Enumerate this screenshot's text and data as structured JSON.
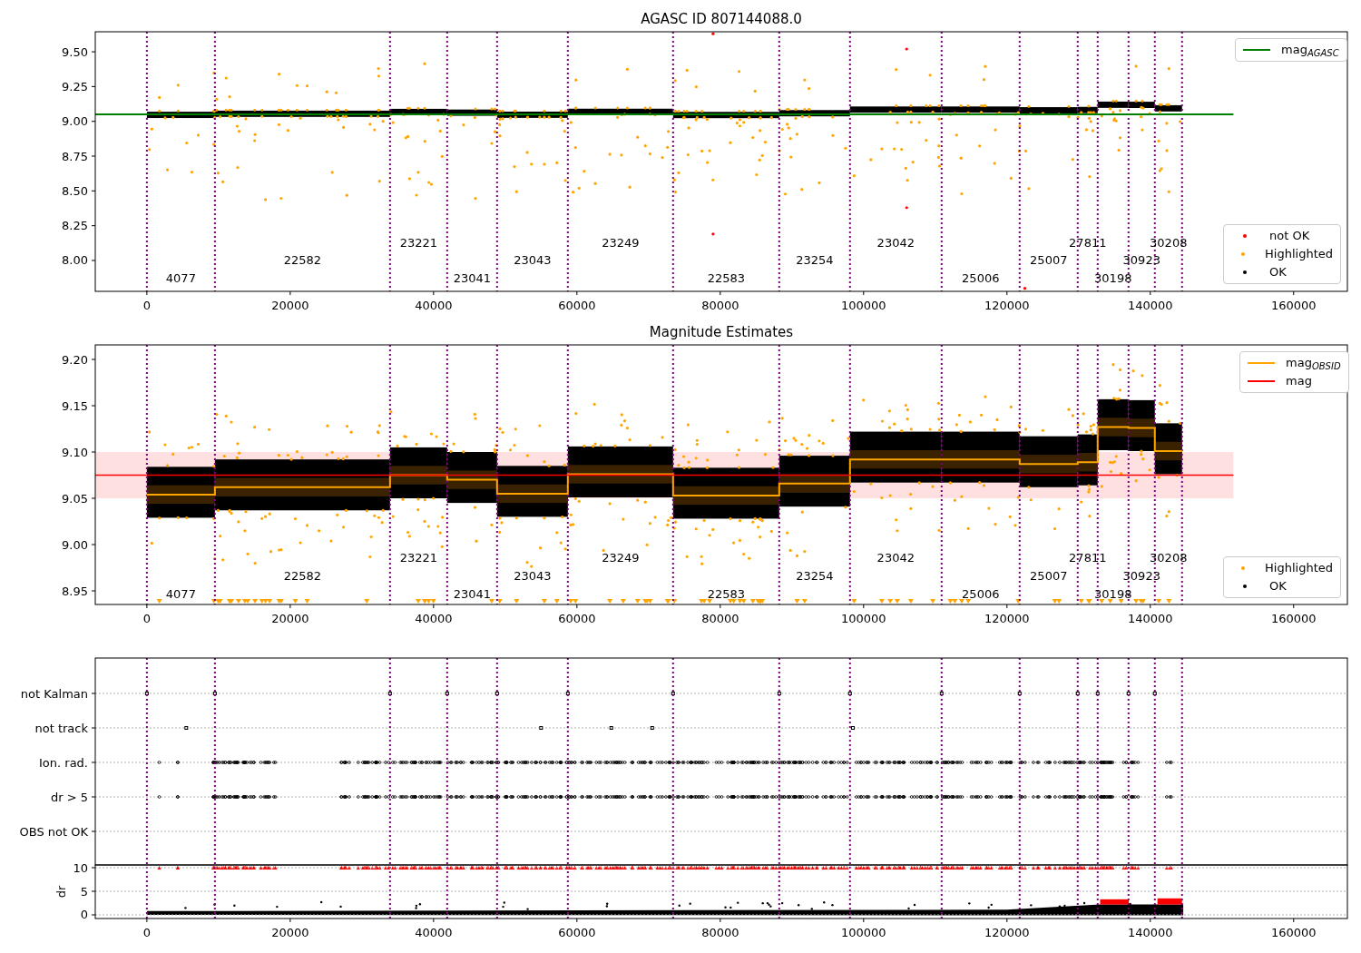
{
  "figure": [
    {
      "kind": "agasc",
      "legends": [
        {
          "kind": "points",
          "entries": [
            {
              "label": "not OK",
              "color": "#ff0000"
            },
            {
              "label": "Highlighted",
              "color": "#ffa500"
            },
            {
              "label": "OK",
              "color": "#000000"
            }
          ]
        }
      ],
      "chart_data": {
        "type": "line",
        "title": "AGASC ID 807144088.0",
        "x": [
          -7200,
          151600
        ],
        "series": [
          {
            "name": "mag$_{AGASC}$",
            "color": "#008000",
            "values": [
              9.05,
              9.05
            ]
          }
        ],
        "xlim": [
          -7200,
          167500
        ],
        "ylim": [
          7.778,
          9.644
        ],
        "xticks": [
          0,
          20000,
          40000,
          60000,
          80000,
          100000,
          120000,
          140000,
          160000
        ],
        "yticks": [
          {
            "value": 8,
            "label": "8.00"
          },
          {
            "value": 8.25,
            "label": "8.25"
          },
          {
            "value": 8.5,
            "label": "8.50"
          },
          {
            "value": 8.75,
            "label": "8.75"
          },
          {
            "value": 9,
            "label": "9.00"
          },
          {
            "value": 9.25,
            "label": "9.25"
          },
          {
            "value": 9.5,
            "label": "9.50"
          }
        ],
        "annotations": [
          "4077",
          "22582",
          "23221",
          "23041",
          "23043",
          "23249",
          "22583",
          "23254",
          "23042",
          "25006",
          "25007",
          "27811",
          "30198",
          "30923",
          "30208"
        ]
      }
    },
    {
      "kind": "estimates",
      "legends": [
        {
          "kind": "points",
          "entries": [
            {
              "label": "Highlighted",
              "color": "#ffa500"
            },
            {
              "label": "OK",
              "color": "#000000"
            }
          ]
        }
      ],
      "chart_data": {
        "type": "line",
        "title": "Magnitude Estimates",
        "x": [
          -7200,
          0,
          9494,
          9494,
          33924,
          33924,
          41899,
          41899,
          48861,
          48861,
          58734,
          58734,
          73418,
          73418,
          88228,
          88228,
          98101,
          98101,
          110886,
          110886,
          121772,
          121772,
          129873,
          129873,
          132658,
          132658,
          136962,
          136962,
          140633,
          140633,
          144430,
          151600
        ],
        "series": [
          {
            "name": "mag$_{OBSID}$",
            "color": "#ffa500",
            "values": [
              null,
              9.054,
              9.054,
              9.062,
              9.062,
              9.075,
              9.075,
              9.07,
              9.07,
              9.055,
              9.055,
              9.076,
              9.076,
              9.053,
              9.053,
              9.066,
              9.066,
              9.092,
              9.092,
              9.092,
              9.092,
              9.087,
              9.087,
              9.089,
              9.089,
              9.127,
              9.127,
              9.126,
              9.126,
              9.101,
              9.101,
              null
            ]
          },
          {
            "name": "mag",
            "color": "#ff0000",
            "values": [
              9.075,
              9.075,
              9.075,
              9.075,
              9.075,
              9.075,
              9.075,
              9.075,
              9.075,
              9.075,
              9.075,
              9.075,
              9.075,
              9.075,
              9.075,
              9.075,
              9.075,
              9.075,
              9.075,
              9.075,
              9.075,
              9.075,
              9.075,
              9.075,
              9.075,
              9.075,
              9.075,
              9.075,
              9.075,
              9.075,
              9.075,
              9.075
            ]
          }
        ],
        "xlim": [
          -7200,
          167500
        ],
        "ylim": [
          8.9353,
          9.2157
        ],
        "xticks": [
          0,
          20000,
          40000,
          60000,
          80000,
          100000,
          120000,
          140000,
          160000
        ],
        "yticks": [
          {
            "value": 8.95,
            "label": "8.95"
          },
          {
            "value": 9,
            "label": "9.00"
          },
          {
            "value": 9.05,
            "label": "9.05"
          },
          {
            "value": 9.1,
            "label": "9.10"
          },
          {
            "value": 9.15,
            "label": "9.15"
          },
          {
            "value": 9.2,
            "label": "9.20"
          }
        ],
        "annotations": [
          "4077",
          "22582",
          "23221",
          "23041",
          "23043",
          "23249",
          "22583",
          "23254",
          "23042",
          "25006",
          "25007",
          "27811",
          "30198",
          "30923",
          "30208"
        ]
      }
    },
    {
      "kind": "flags",
      "flag_labels": [
        "not Kalman",
        "not track",
        "Ion. rad.",
        "dr > 5",
        "OBS not OK"
      ],
      "chart_data": {
        "type": "scatter",
        "ylabel": "dr",
        "xlim": [
          -7200,
          167500
        ],
        "ylim": [
          -0.77,
          10.58
        ],
        "xticks": [
          0,
          20000,
          40000,
          60000,
          80000,
          100000,
          120000,
          140000,
          160000
        ],
        "yticks": [
          0,
          5,
          10
        ],
        "grid": true
      }
    }
  ]
}
